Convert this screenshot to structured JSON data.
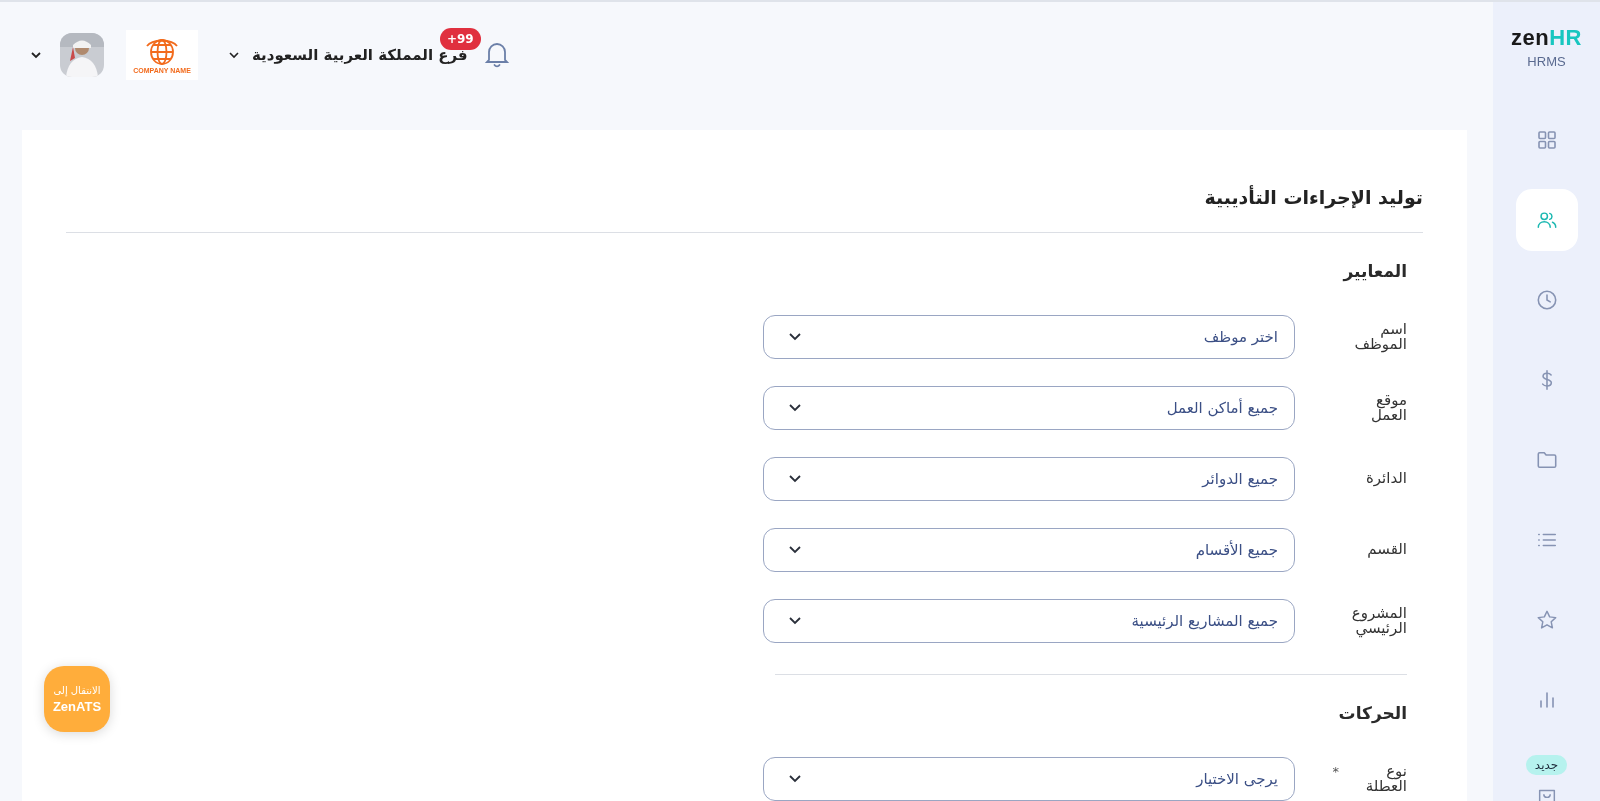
{
  "sidebar": {
    "logo_first": "zen",
    "logo_second": "HR",
    "product": "HRMS",
    "items": [
      {
        "kind": "grid",
        "selected": false
      },
      {
        "kind": "users",
        "selected": true
      },
      {
        "kind": "clock",
        "selected": false
      },
      {
        "kind": "dollar",
        "selected": false
      },
      {
        "kind": "folder",
        "selected": false
      },
      {
        "kind": "list",
        "selected": false
      },
      {
        "kind": "star",
        "selected": false
      },
      {
        "kind": "chart",
        "selected": false
      },
      {
        "kind": "bag",
        "selected": false,
        "badge": "جديد"
      }
    ]
  },
  "header": {
    "notifications": "+99",
    "branch": "فرع المملكة العربية السعودية",
    "company_logo_text": "COMPANY NAME"
  },
  "page": {
    "title": "توليد الإجراءات التأديبية",
    "sections": [
      {
        "heading": "المعايير",
        "fields": [
          {
            "label": "اسم الموظف",
            "placeholder": "اختر موظف"
          },
          {
            "label": "موقع العمل",
            "value": "جميع أماكن العمل"
          },
          {
            "label": "الدائرة",
            "value": "جميع الدوائر"
          },
          {
            "label": "القسم",
            "value": "جميع الأقسام"
          },
          {
            "label": "المشروع الرئيسي",
            "value": "جميع المشاريع الرئيسية"
          }
        ]
      },
      {
        "heading": "الحركات",
        "fields": [
          {
            "label": "نوع العطلة",
            "required_mark": "*",
            "placeholder": "يرجى الاختيار"
          }
        ]
      }
    ]
  },
  "ats_button": {
    "line_1": "الانتقال إلى",
    "line_2": "ZenATS"
  }
}
